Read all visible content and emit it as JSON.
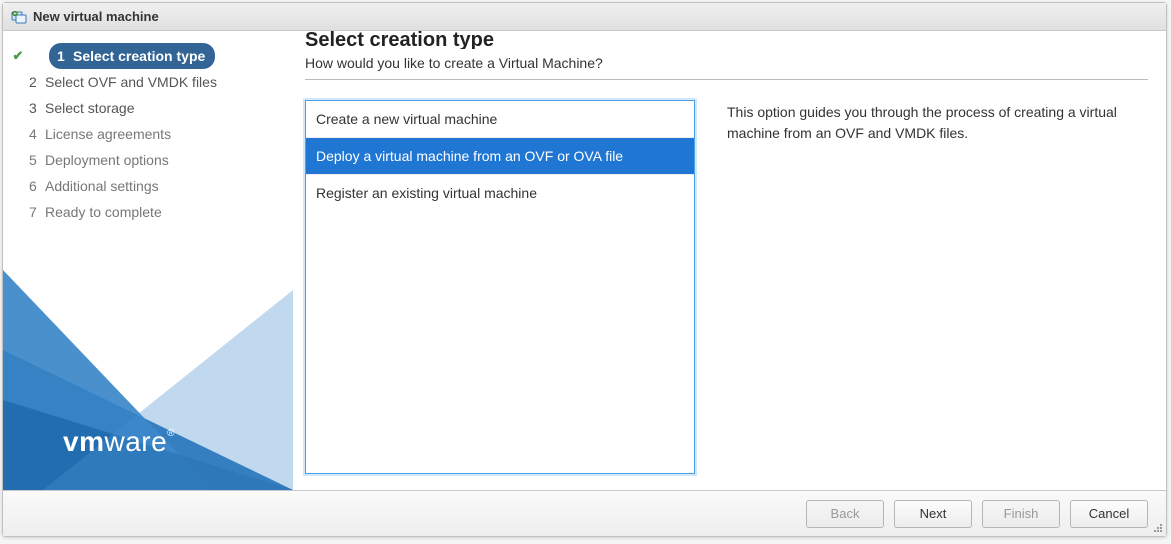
{
  "title": "New virtual machine",
  "steps": [
    {
      "num": "1",
      "label": "Select creation type",
      "state": "active",
      "completed": true
    },
    {
      "num": "2",
      "label": "Select OVF and VMDK files",
      "state": "normal",
      "completed": false
    },
    {
      "num": "3",
      "label": "Select storage",
      "state": "normal",
      "completed": false
    },
    {
      "num": "4",
      "label": "License agreements",
      "state": "disabled",
      "completed": false
    },
    {
      "num": "5",
      "label": "Deployment options",
      "state": "disabled",
      "completed": false
    },
    {
      "num": "6",
      "label": "Additional settings",
      "state": "disabled",
      "completed": false
    },
    {
      "num": "7",
      "label": "Ready to complete",
      "state": "disabled",
      "completed": false
    }
  ],
  "logo": {
    "bold": "vm",
    "light": "ware",
    "reg": "®"
  },
  "stage": {
    "title": "Select creation type",
    "subtitle": "How would you like to create a Virtual Machine?"
  },
  "options": [
    {
      "label": "Create a new virtual machine",
      "selected": false
    },
    {
      "label": "Deploy a virtual machine from an OVF or OVA file",
      "selected": true
    },
    {
      "label": "Register an existing virtual machine",
      "selected": false
    }
  ],
  "description": "This option guides you through the process of creating a virtual machine from an OVF and VMDK files.",
  "buttons": {
    "back": "Back",
    "next": "Next",
    "finish": "Finish",
    "cancel": "Cancel"
  },
  "buttons_enabled": {
    "back": false,
    "next": true,
    "finish": false,
    "cancel": true
  }
}
